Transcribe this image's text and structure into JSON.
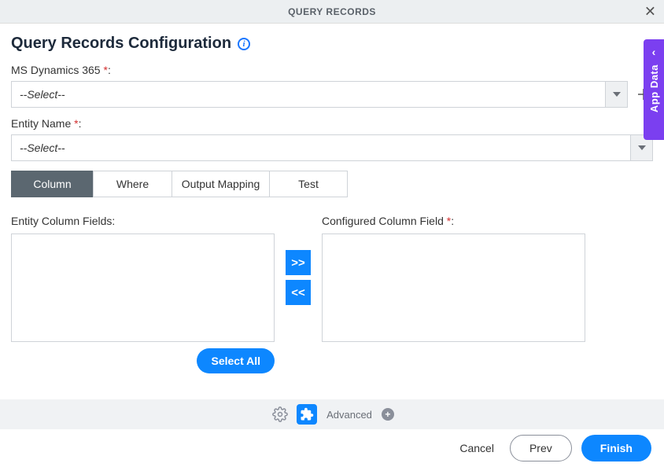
{
  "header": {
    "title": "QUERY RECORDS"
  },
  "page": {
    "title": "Query Records Configuration"
  },
  "fields": {
    "dynamics": {
      "label": "MS Dynamics 365",
      "req": "*",
      "colon": ":",
      "selected": "--Select--"
    },
    "entity": {
      "label": "Entity Name",
      "req": "*",
      "colon": ":",
      "selected": "--Select--"
    }
  },
  "tabs": {
    "column": "Column",
    "where": "Where",
    "output": "Output Mapping",
    "test": "Test"
  },
  "columns": {
    "left_label": "Entity Column Fields:",
    "right_label": "Configured Column Field",
    "right_req": "*",
    "right_colon": ":",
    "move_right": ">>",
    "move_left": "<<",
    "select_all": "Select All"
  },
  "footer": {
    "advanced": "Advanced",
    "add_plus": "+"
  },
  "actions": {
    "cancel": "Cancel",
    "prev": "Prev",
    "finish": "Finish"
  },
  "sidepanel": {
    "label": "App Data",
    "chevron": "‹"
  }
}
